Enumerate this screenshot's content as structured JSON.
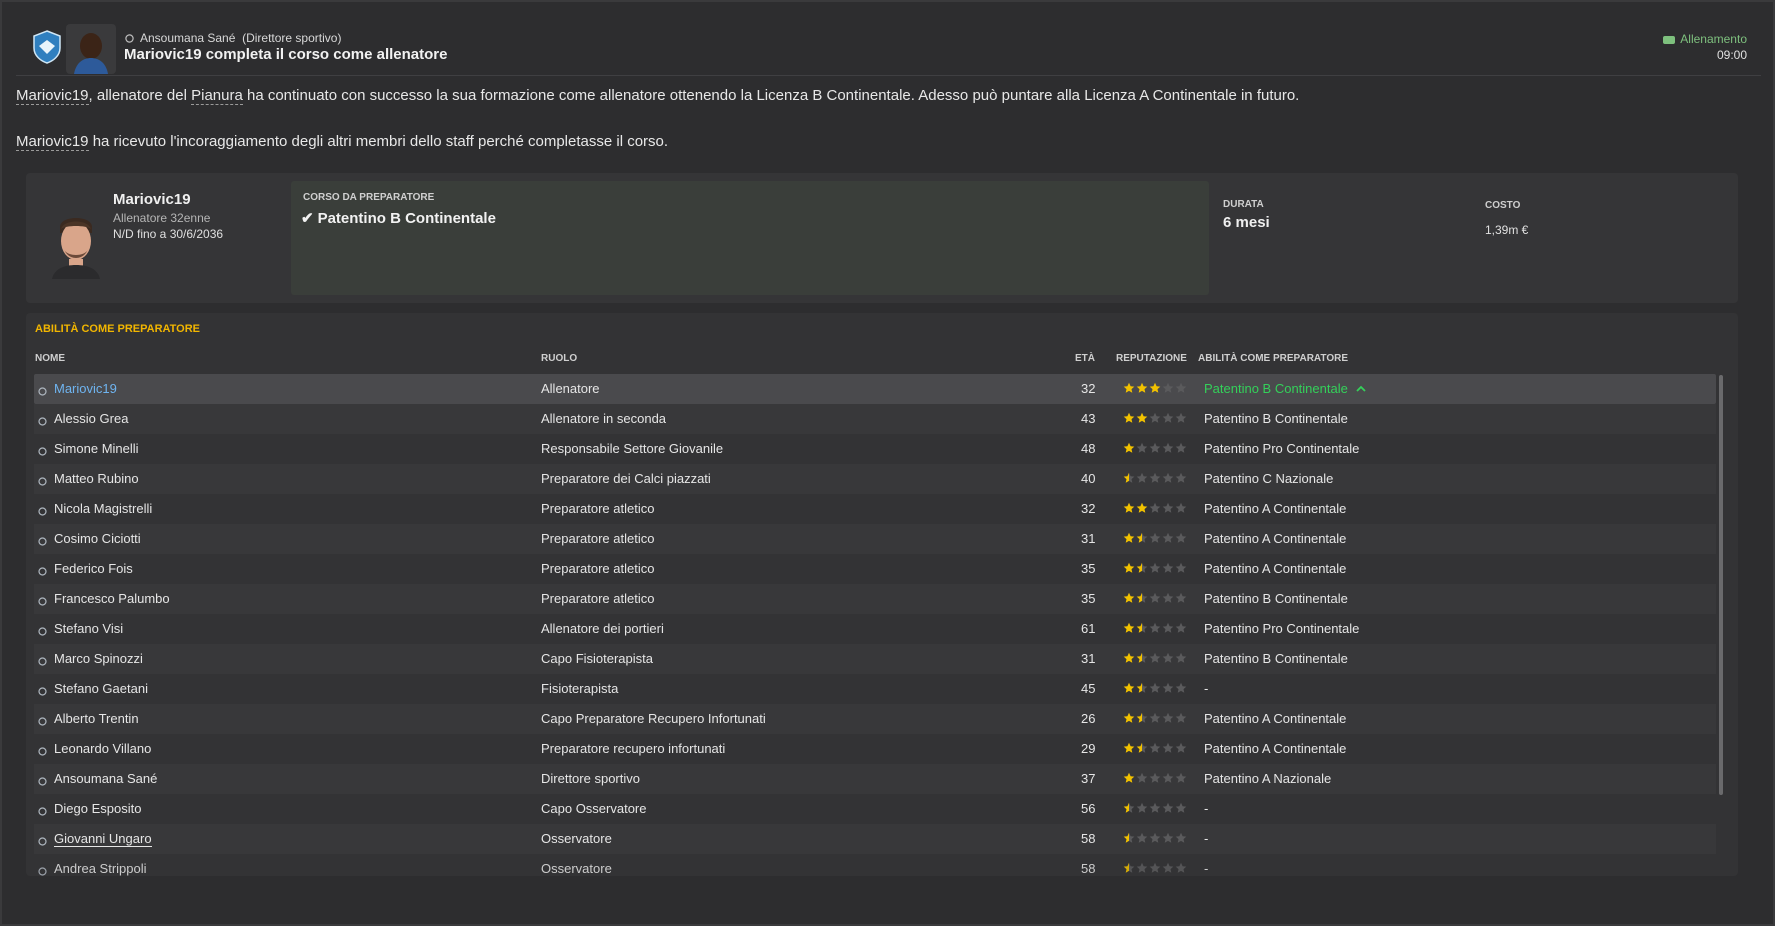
{
  "header": {
    "sender_name": "Ansoumana Sané",
    "sender_role": "(Direttore sportivo)",
    "title": "Mariovic19 completa il corso come allenatore",
    "category": "Allenamento",
    "time": "09:00"
  },
  "body": {
    "p1_name": "Mariovic19",
    "p1_a": ", allenatore del ",
    "p1_club": "Pianura",
    "p1_b": " ha continuato con successo la sua formazione come allenatore ottenendo la Licenza B Continentale. Adesso può puntare alla Licenza A Continentale in futuro.",
    "p2_name": "Mariovic19",
    "p2_a": " ha ricevuto l'incoraggiamento degli altri membri dello staff perché completasse il corso."
  },
  "course": {
    "coach_name": "Mariovic19",
    "coach_sub": "Allenatore 32enne",
    "coach_contract": "N/D fino a 30/6/2036",
    "course_label": "CORSO DA PREPARATORE",
    "course_name": "Patentino B Continentale",
    "duration_label": "DURATA",
    "duration_value": "6 mesi",
    "cost_label": "COSTO",
    "cost_value": "1,39m €"
  },
  "staff": {
    "section_title": "ABILITÀ COME PREPARATORE",
    "headers": {
      "name": "NOME",
      "role": "RUOLO",
      "age": "ETÀ",
      "reputation": "REPUTAZIONE",
      "ability": "ABILITÀ COME PREPARATORE"
    },
    "rows": [
      {
        "name": "Mariovic19",
        "role": "Allenatore",
        "age": "32",
        "stars": 3,
        "ability": "Patentino B Continentale"
      },
      {
        "name": "Alessio Grea",
        "role": "Allenatore in seconda",
        "age": "43",
        "stars": 2,
        "ability": "Patentino B Continentale"
      },
      {
        "name": "Simone Minelli",
        "role": "Responsabile Settore Giovanile",
        "age": "48",
        "stars": 1,
        "ability": "Patentino Pro Continentale"
      },
      {
        "name": "Matteo Rubino",
        "role": "Preparatore dei Calci piazzati",
        "age": "40",
        "stars": 0.5,
        "ability": "Patentino C Nazionale"
      },
      {
        "name": "Nicola Magistrelli",
        "role": "Preparatore atletico",
        "age": "32",
        "stars": 2,
        "ability": "Patentino A Continentale"
      },
      {
        "name": "Cosimo Ciciotti",
        "role": "Preparatore atletico",
        "age": "31",
        "stars": 1.5,
        "ability": "Patentino A Continentale"
      },
      {
        "name": "Federico Fois",
        "role": "Preparatore atletico",
        "age": "35",
        "stars": 1.5,
        "ability": "Patentino A Continentale"
      },
      {
        "name": "Francesco Palumbo",
        "role": "Preparatore atletico",
        "age": "35",
        "stars": 1.5,
        "ability": "Patentino B Continentale"
      },
      {
        "name": "Stefano Visi",
        "role": "Allenatore dei portieri",
        "age": "61",
        "stars": 1.5,
        "ability": "Patentino Pro Continentale"
      },
      {
        "name": "Marco Spinozzi",
        "role": "Capo Fisioterapista",
        "age": "31",
        "stars": 1.5,
        "ability": "Patentino B Continentale"
      },
      {
        "name": "Stefano Gaetani",
        "role": "Fisioterapista",
        "age": "45",
        "stars": 1.5,
        "ability": "-"
      },
      {
        "name": "Alberto Trentin",
        "role": "Capo Preparatore Recupero Infortunati",
        "age": "26",
        "stars": 1.5,
        "ability": "Patentino A Continentale"
      },
      {
        "name": "Leonardo Villano",
        "role": "Preparatore recupero infortunati",
        "age": "29",
        "stars": 1.5,
        "ability": "Patentino A Continentale"
      },
      {
        "name": "Ansoumana Sané",
        "role": "Direttore sportivo",
        "age": "37",
        "stars": 1,
        "ability": "Patentino A Nazionale"
      },
      {
        "name": "Diego Esposito",
        "role": "Capo Osservatore",
        "age": "56",
        "stars": 0.5,
        "ability": "-"
      },
      {
        "name": "Giovanni Ungaro",
        "role": "Osservatore",
        "age": "58",
        "stars": 0.5,
        "ability": "-"
      },
      {
        "name": "Andrea Strippoli",
        "role": "Osservatore",
        "age": "58",
        "stars": 0.5,
        "ability": "-"
      }
    ]
  },
  "colors": {
    "accent_gold": "#f2b600",
    "link_blue": "#6fb4f0",
    "positive_green": "#34d05a",
    "star_gold": "#f2c200",
    "star_empty": "#5a5a5c"
  }
}
